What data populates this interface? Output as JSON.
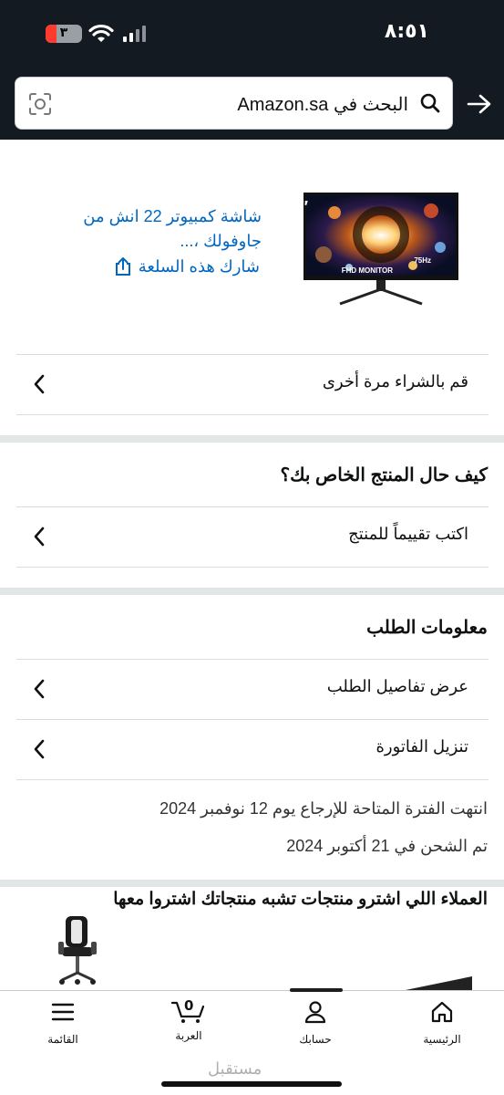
{
  "status_bar": {
    "time": "٨:٥١",
    "battery": "٣"
  },
  "search": {
    "placeholder": "البحث في Amazon.sa"
  },
  "product": {
    "title": "شاشة كمبيوتر 22 انش من جاوفولك ،...",
    "share_label": "شارك هذه السلعة"
  },
  "buy_again": {
    "label": "قم بالشراء مرة أخرى"
  },
  "review_section": {
    "title": "كيف حال المنتج الخاص بك؟",
    "write_review": "اكتب تقييماً للمنتج"
  },
  "order_info": {
    "title": "معلومات الطلب",
    "view_details": "عرض تفاصيل الطلب",
    "download_invoice": "تنزيل الفاتورة",
    "return_window": "انتهت الفترة المتاحة للإرجاع يوم 12 نوفمبر 2024",
    "shipped": "تم الشحن في 21 أكتوبر 2024"
  },
  "related": {
    "title": "العملاء اللي اشترو منتجات تشبه منتجاتك اشتروا معها"
  },
  "bottom_nav": {
    "home": "الرئيسية",
    "account": "حسابك",
    "cart": "العربة",
    "cart_count": "0",
    "menu": "القائمة"
  },
  "watermark": "مستقبل"
}
